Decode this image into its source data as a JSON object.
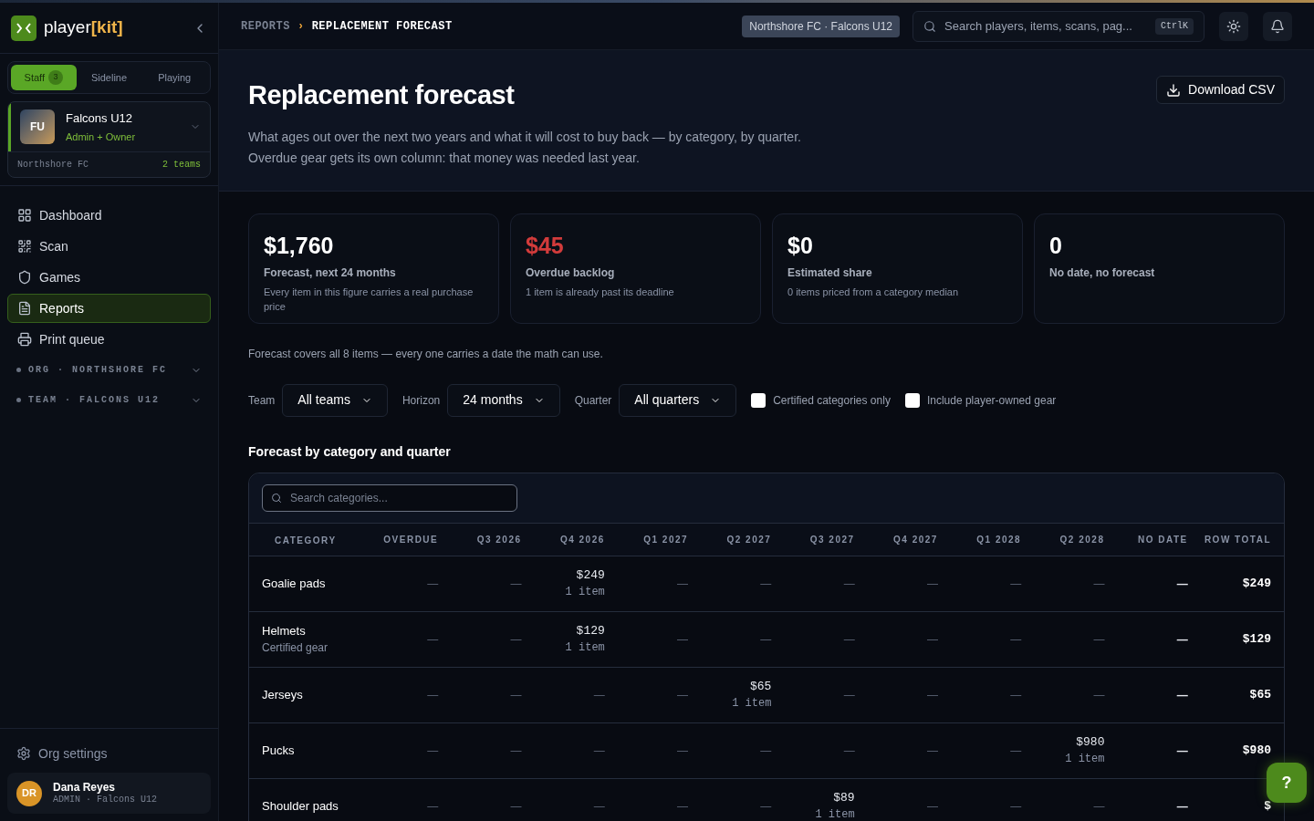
{
  "brand": {
    "name": "player",
    "accent": "[kit]"
  },
  "role_tabs": [
    {
      "label": "Staff",
      "badge": "3",
      "selected": true
    },
    {
      "label": "Sideline",
      "selected": false
    },
    {
      "label": "Playing",
      "selected": false
    }
  ],
  "team_card": {
    "initials": "FU",
    "name": "Falcons U12",
    "role": "Admin + Owner",
    "org": "Northshore FC",
    "teams": "2 teams"
  },
  "nav": [
    {
      "label": "Dashboard",
      "selected": false
    },
    {
      "label": "Scan",
      "selected": false
    },
    {
      "label": "Games",
      "selected": false
    },
    {
      "label": "Reports",
      "selected": true
    },
    {
      "label": "Print queue",
      "selected": false
    }
  ],
  "nav_groups": [
    {
      "label": "ORG · NORTHSHORE FC",
      "expanded": false
    },
    {
      "label": "TEAM · FALCONS U12",
      "expanded": false
    }
  ],
  "org_settings": "Org settings",
  "user": {
    "initials": "DR",
    "name": "Dana Reyes",
    "role": "ADMIN · Falcons U12"
  },
  "breadcrumb": [
    {
      "label": "REPORTS"
    },
    {
      "label": "REPLACEMENT FORECAST"
    }
  ],
  "breadcrumb_separator": "›",
  "scope_chip": "Northshore FC · Falcons U12",
  "search": {
    "placeholder": "Search players, items, scans, pag...",
    "shortcut": "CtrlK"
  },
  "page": {
    "title": "Replacement forecast",
    "description": "What ages out over the next two years and what it will cost to buy back — by category, by quarter. Overdue gear gets its own column: that money was needed last year.",
    "download": "Download CSV"
  },
  "stats": [
    {
      "value": "$1,760",
      "label": "Forecast, next 24 months",
      "note": "Every item in this figure carries a real purchase price",
      "alert": false
    },
    {
      "value": "$45",
      "label": "Overdue backlog",
      "note": "1 item is already past its deadline",
      "alert": true
    },
    {
      "value": "$0",
      "label": "Estimated share",
      "note": "0 items priced from a category median",
      "alert": false
    },
    {
      "value": "0",
      "label": "No date, no forecast",
      "alert": false
    }
  ],
  "coverage_note": "Forecast covers all 8 items — every one carries a date the math can use.",
  "filters": [
    {
      "kind": "select",
      "label": "Team",
      "value": "All teams"
    },
    {
      "kind": "select",
      "label": "Horizon",
      "value": "24 months"
    },
    {
      "kind": "select",
      "label": "Quarter",
      "value": "All quarters"
    },
    {
      "kind": "checkbox",
      "label": "Certified categories only",
      "checked": false
    },
    {
      "kind": "checkbox",
      "label": "Include player-owned gear",
      "checked": false
    }
  ],
  "section_title": "Forecast by category and quarter",
  "table": {
    "search_placeholder": "Search categories...",
    "columns": [
      "CATEGORY",
      "OVERDUE",
      "Q3 2026",
      "Q4 2026",
      "Q1 2027",
      "Q2 2027",
      "Q3 2027",
      "Q4 2027",
      "Q1 2028",
      "Q2 2028",
      "NO DATE",
      "ROW TOTAL"
    ],
    "rows": [
      {
        "cells": [
          {
            "kind": "category",
            "text": "Goalie pads"
          },
          {
            "kind": "empty",
            "text": "—"
          },
          {
            "kind": "empty",
            "text": "—"
          },
          {
            "kind": "amount",
            "amount": "$249",
            "count": "1 item"
          },
          {
            "kind": "empty",
            "text": "—"
          },
          {
            "kind": "empty",
            "text": "—"
          },
          {
            "kind": "empty",
            "text": "—"
          },
          {
            "kind": "empty",
            "text": "—"
          },
          {
            "kind": "empty",
            "text": "—"
          },
          {
            "kind": "empty",
            "text": "—"
          },
          {
            "kind": "nodate",
            "text": "—"
          },
          {
            "kind": "total",
            "text": "$249"
          }
        ]
      },
      {
        "cells": [
          {
            "kind": "category",
            "text": "Helmets",
            "sub": "Certified gear"
          },
          {
            "kind": "empty",
            "text": "—"
          },
          {
            "kind": "empty",
            "text": "—"
          },
          {
            "kind": "amount",
            "amount": "$129",
            "count": "1 item"
          },
          {
            "kind": "empty",
            "text": "—"
          },
          {
            "kind": "empty",
            "text": "—"
          },
          {
            "kind": "empty",
            "text": "—"
          },
          {
            "kind": "empty",
            "text": "—"
          },
          {
            "kind": "empty",
            "text": "—"
          },
          {
            "kind": "empty",
            "text": "—"
          },
          {
            "kind": "nodate",
            "text": "—"
          },
          {
            "kind": "total",
            "text": "$129"
          }
        ]
      },
      {
        "cells": [
          {
            "kind": "category",
            "text": "Jerseys"
          },
          {
            "kind": "empty",
            "text": "—"
          },
          {
            "kind": "empty",
            "text": "—"
          },
          {
            "kind": "empty",
            "text": "—"
          },
          {
            "kind": "empty",
            "text": "—"
          },
          {
            "kind": "amount",
            "amount": "$65",
            "count": "1 item"
          },
          {
            "kind": "empty",
            "text": "—"
          },
          {
            "kind": "empty",
            "text": "—"
          },
          {
            "kind": "empty",
            "text": "—"
          },
          {
            "kind": "empty",
            "text": "—"
          },
          {
            "kind": "nodate",
            "text": "—"
          },
          {
            "kind": "total",
            "text": "$65"
          }
        ]
      },
      {
        "cells": [
          {
            "kind": "category",
            "text": "Pucks"
          },
          {
            "kind": "empty",
            "text": "—"
          },
          {
            "kind": "empty",
            "text": "—"
          },
          {
            "kind": "empty",
            "text": "—"
          },
          {
            "kind": "empty",
            "text": "—"
          },
          {
            "kind": "empty",
            "text": "—"
          },
          {
            "kind": "empty",
            "text": "—"
          },
          {
            "kind": "empty",
            "text": "—"
          },
          {
            "kind": "empty",
            "text": "—"
          },
          {
            "kind": "amount",
            "amount": "$980",
            "count": "1 item"
          },
          {
            "kind": "nodate",
            "text": "—"
          },
          {
            "kind": "total",
            "text": "$980"
          }
        ]
      },
      {
        "cells": [
          {
            "kind": "category",
            "text": "Shoulder pads"
          },
          {
            "kind": "empty",
            "text": "—"
          },
          {
            "kind": "empty",
            "text": "—"
          },
          {
            "kind": "empty",
            "text": "—"
          },
          {
            "kind": "empty",
            "text": "—"
          },
          {
            "kind": "empty",
            "text": "—"
          },
          {
            "kind": "amount",
            "amount": "$89",
            "count": "1 item"
          },
          {
            "kind": "empty",
            "text": "—"
          },
          {
            "kind": "empty",
            "text": "—"
          },
          {
            "kind": "empty",
            "text": "—"
          },
          {
            "kind": "nodate",
            "text": "—"
          },
          {
            "kind": "total",
            "text": "$"
          }
        ]
      }
    ]
  },
  "help_button": "?"
}
